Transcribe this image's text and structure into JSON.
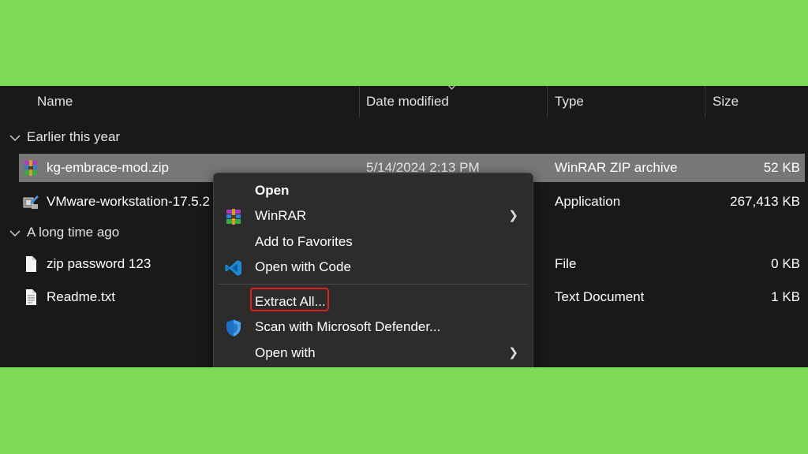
{
  "columns": {
    "name": "Name",
    "date_modified": "Date modified",
    "type": "Type",
    "size": "Size"
  },
  "groups": [
    {
      "label": "Earlier this year"
    },
    {
      "label": "A long time ago"
    }
  ],
  "files": [
    {
      "name": "kg-embrace-mod.zip",
      "date": "5/14/2024 2:13 PM",
      "type": "WinRAR ZIP archive",
      "size": "52 KB",
      "icon": "winrar-archive-icon",
      "selected": true
    },
    {
      "name": "VMware-workstation-17.5.2",
      "date": "",
      "type": "Application",
      "size": "267,413 KB",
      "icon": "vmware-installer-icon"
    },
    {
      "name": "zip password 123",
      "date": "",
      "type": "File",
      "size": "0 KB",
      "icon": "blank-file-icon"
    },
    {
      "name": "Readme.txt",
      "date": "",
      "type": "Text Document",
      "size": "1 KB",
      "icon": "text-document-icon"
    }
  ],
  "context_menu": {
    "items": [
      {
        "label": "Open",
        "icon": "",
        "submenu": false
      },
      {
        "label": "WinRAR",
        "icon": "winrar-icon",
        "submenu": true
      },
      {
        "label": "Add to Favorites",
        "icon": "",
        "submenu": false
      },
      {
        "label": "Open with Code",
        "icon": "vscode-icon",
        "submenu": false
      },
      {
        "label": "Extract All...",
        "icon": "",
        "submenu": false,
        "highlighted": true
      },
      {
        "label": "Scan with Microsoft Defender...",
        "icon": "defender-shield-icon",
        "submenu": false
      },
      {
        "label": "Open with",
        "icon": "",
        "submenu": true
      }
    ]
  },
  "colors": {
    "background": "#7ed957",
    "explorer_bg": "#191919",
    "selection": "#777777",
    "menu_bg": "#2c2c2c",
    "highlight_border": "#e01e1e"
  }
}
